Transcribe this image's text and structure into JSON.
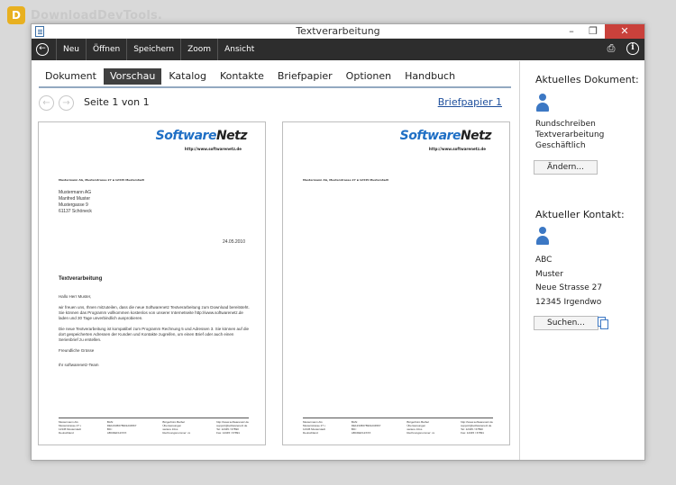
{
  "watermark": {
    "logo_letter": "D",
    "text": "DownloadDevTools."
  },
  "window": {
    "title": "Textverarbeitung",
    "buttons": {
      "minimize": "–",
      "maximize": "❐",
      "close": "✕"
    }
  },
  "toolbar": {
    "back": "←",
    "items": [
      "Neu",
      "Öffnen",
      "Speichern",
      "Zoom",
      "Ansicht"
    ],
    "icons": {
      "print": "⎙",
      "info": "i"
    }
  },
  "tabs": [
    "Dokument",
    "Vorschau",
    "Katalog",
    "Kontakte",
    "Briefpapier",
    "Optionen",
    "Handbuch"
  ],
  "active_tab": "Vorschau",
  "nav": {
    "prev": "←",
    "next": "→",
    "page_info": "Seite 1 von 1",
    "briefpapier_link": "Briefpapier 1"
  },
  "letter": {
    "logo_part1": "Software",
    "logo_part2": "Netz",
    "logo_url": "http://www.softwarenetz.de",
    "sender_line": "Mustermann AG, Musterstrasse 27 ▪ 12345 Musterstadt",
    "address": [
      "Mustermann AG",
      "Manfred Muster",
      "Mustergasse 9",
      "61137 Schöneck"
    ],
    "date": "24.05.2010",
    "subject": "Textverarbeitung",
    "greeting": "Hallo Herr Muster,",
    "paragraph1": "wir freuen uns, Ihnen mitzuteilen, dass die neue Softwarenetz Textverarbeitung zum Download bereitsteht. Sie können das Programm vollkommen kostenlos von unserer Internetseite http://www.softwarenetz.de laden und 30 Tage unverbindlich ausprobieren.",
    "paragraph2": "Die neue Textverarbeitung ist kompatibel zum Programm Rechnung 5 und Adressen 3. Sie können auf die dort gespeicherten Adressen der Kunden und Kontakte zugreifen, um einen Brief oder auch einen Serienbrief zu erstellen.",
    "closing": "Freundliche Grüsse",
    "signature": "Ihr softwarenetz-Team",
    "footer": [
      "Mustermann AG\nMusterstrasse 27 ▪\n12345 Musterstadt\nDeutschland",
      "BAN:\nDE12345678901234567\nBIC:\nABCDEF12XXX",
      "Bürgerbüro Barbel\nÜberweisungen\nweitere Infos\nRechnungsnummer: xx",
      "http://www.softwarenetz.de\nsupport@softwarenetz.de\nTel: 12345 / 67890\nFax: 12345 / 67891"
    ]
  },
  "sidebar": {
    "doc_heading": "Aktuelles Dokument:",
    "doc_lines": [
      "Rundschreiben",
      "Textverarbeitung",
      "Geschäftlich"
    ],
    "change_button": "Ändern...",
    "contact_heading": "Aktueller Kontakt:",
    "contact_lines": [
      "ABC",
      "Muster",
      "Neue Strasse 27",
      "12345 Irgendwo"
    ],
    "search_button": "Suchen..."
  },
  "colors": {
    "accent": "#1f6fc5",
    "toolbar": "#2d2d2d",
    "close": "#c9413b",
    "tabline": "#93a9c1"
  }
}
